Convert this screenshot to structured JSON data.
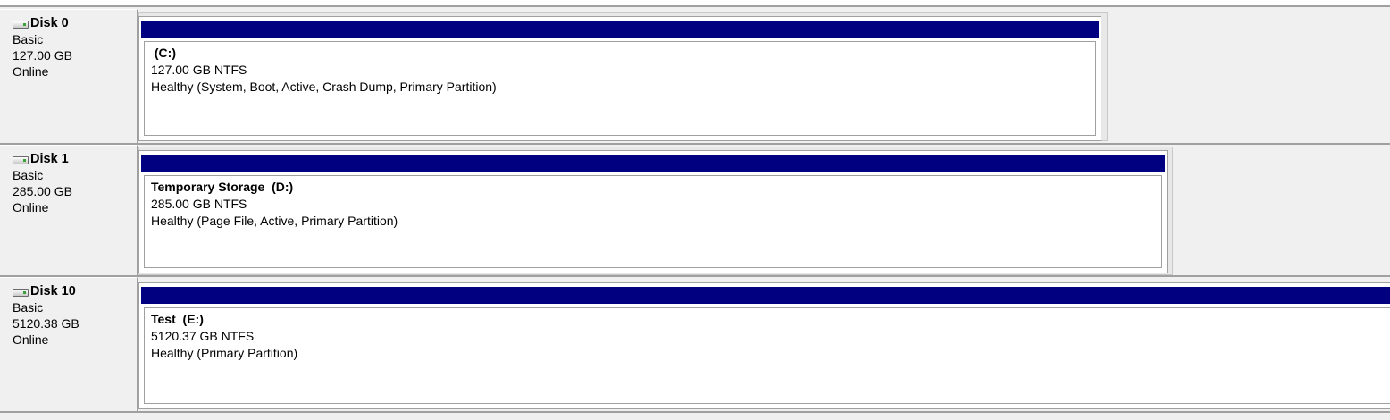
{
  "disks": [
    {
      "name": "Disk 0",
      "type": "Basic",
      "size": "127.00 GB",
      "status": "Online",
      "partition": {
        "name": " (C:)",
        "fs": "127.00 GB NTFS",
        "health": "Healthy (System, Boot, Active, Crash Dump, Primary Partition)"
      }
    },
    {
      "name": "Disk 1",
      "type": "Basic",
      "size": "285.00 GB",
      "status": "Online",
      "partition": {
        "name": "Temporary Storage  (D:)",
        "fs": "285.00 GB NTFS",
        "health": "Healthy (Page File, Active, Primary Partition)"
      }
    },
    {
      "name": "Disk 10",
      "type": "Basic",
      "size": "5120.38 GB",
      "status": "Online",
      "partition": {
        "name": "Test  (E:)",
        "fs": "5120.37 GB NTFS",
        "health": "Healthy (Primary Partition)"
      }
    }
  ],
  "colors": {
    "partition_header": "#000080",
    "background": "#f0f0f0"
  }
}
